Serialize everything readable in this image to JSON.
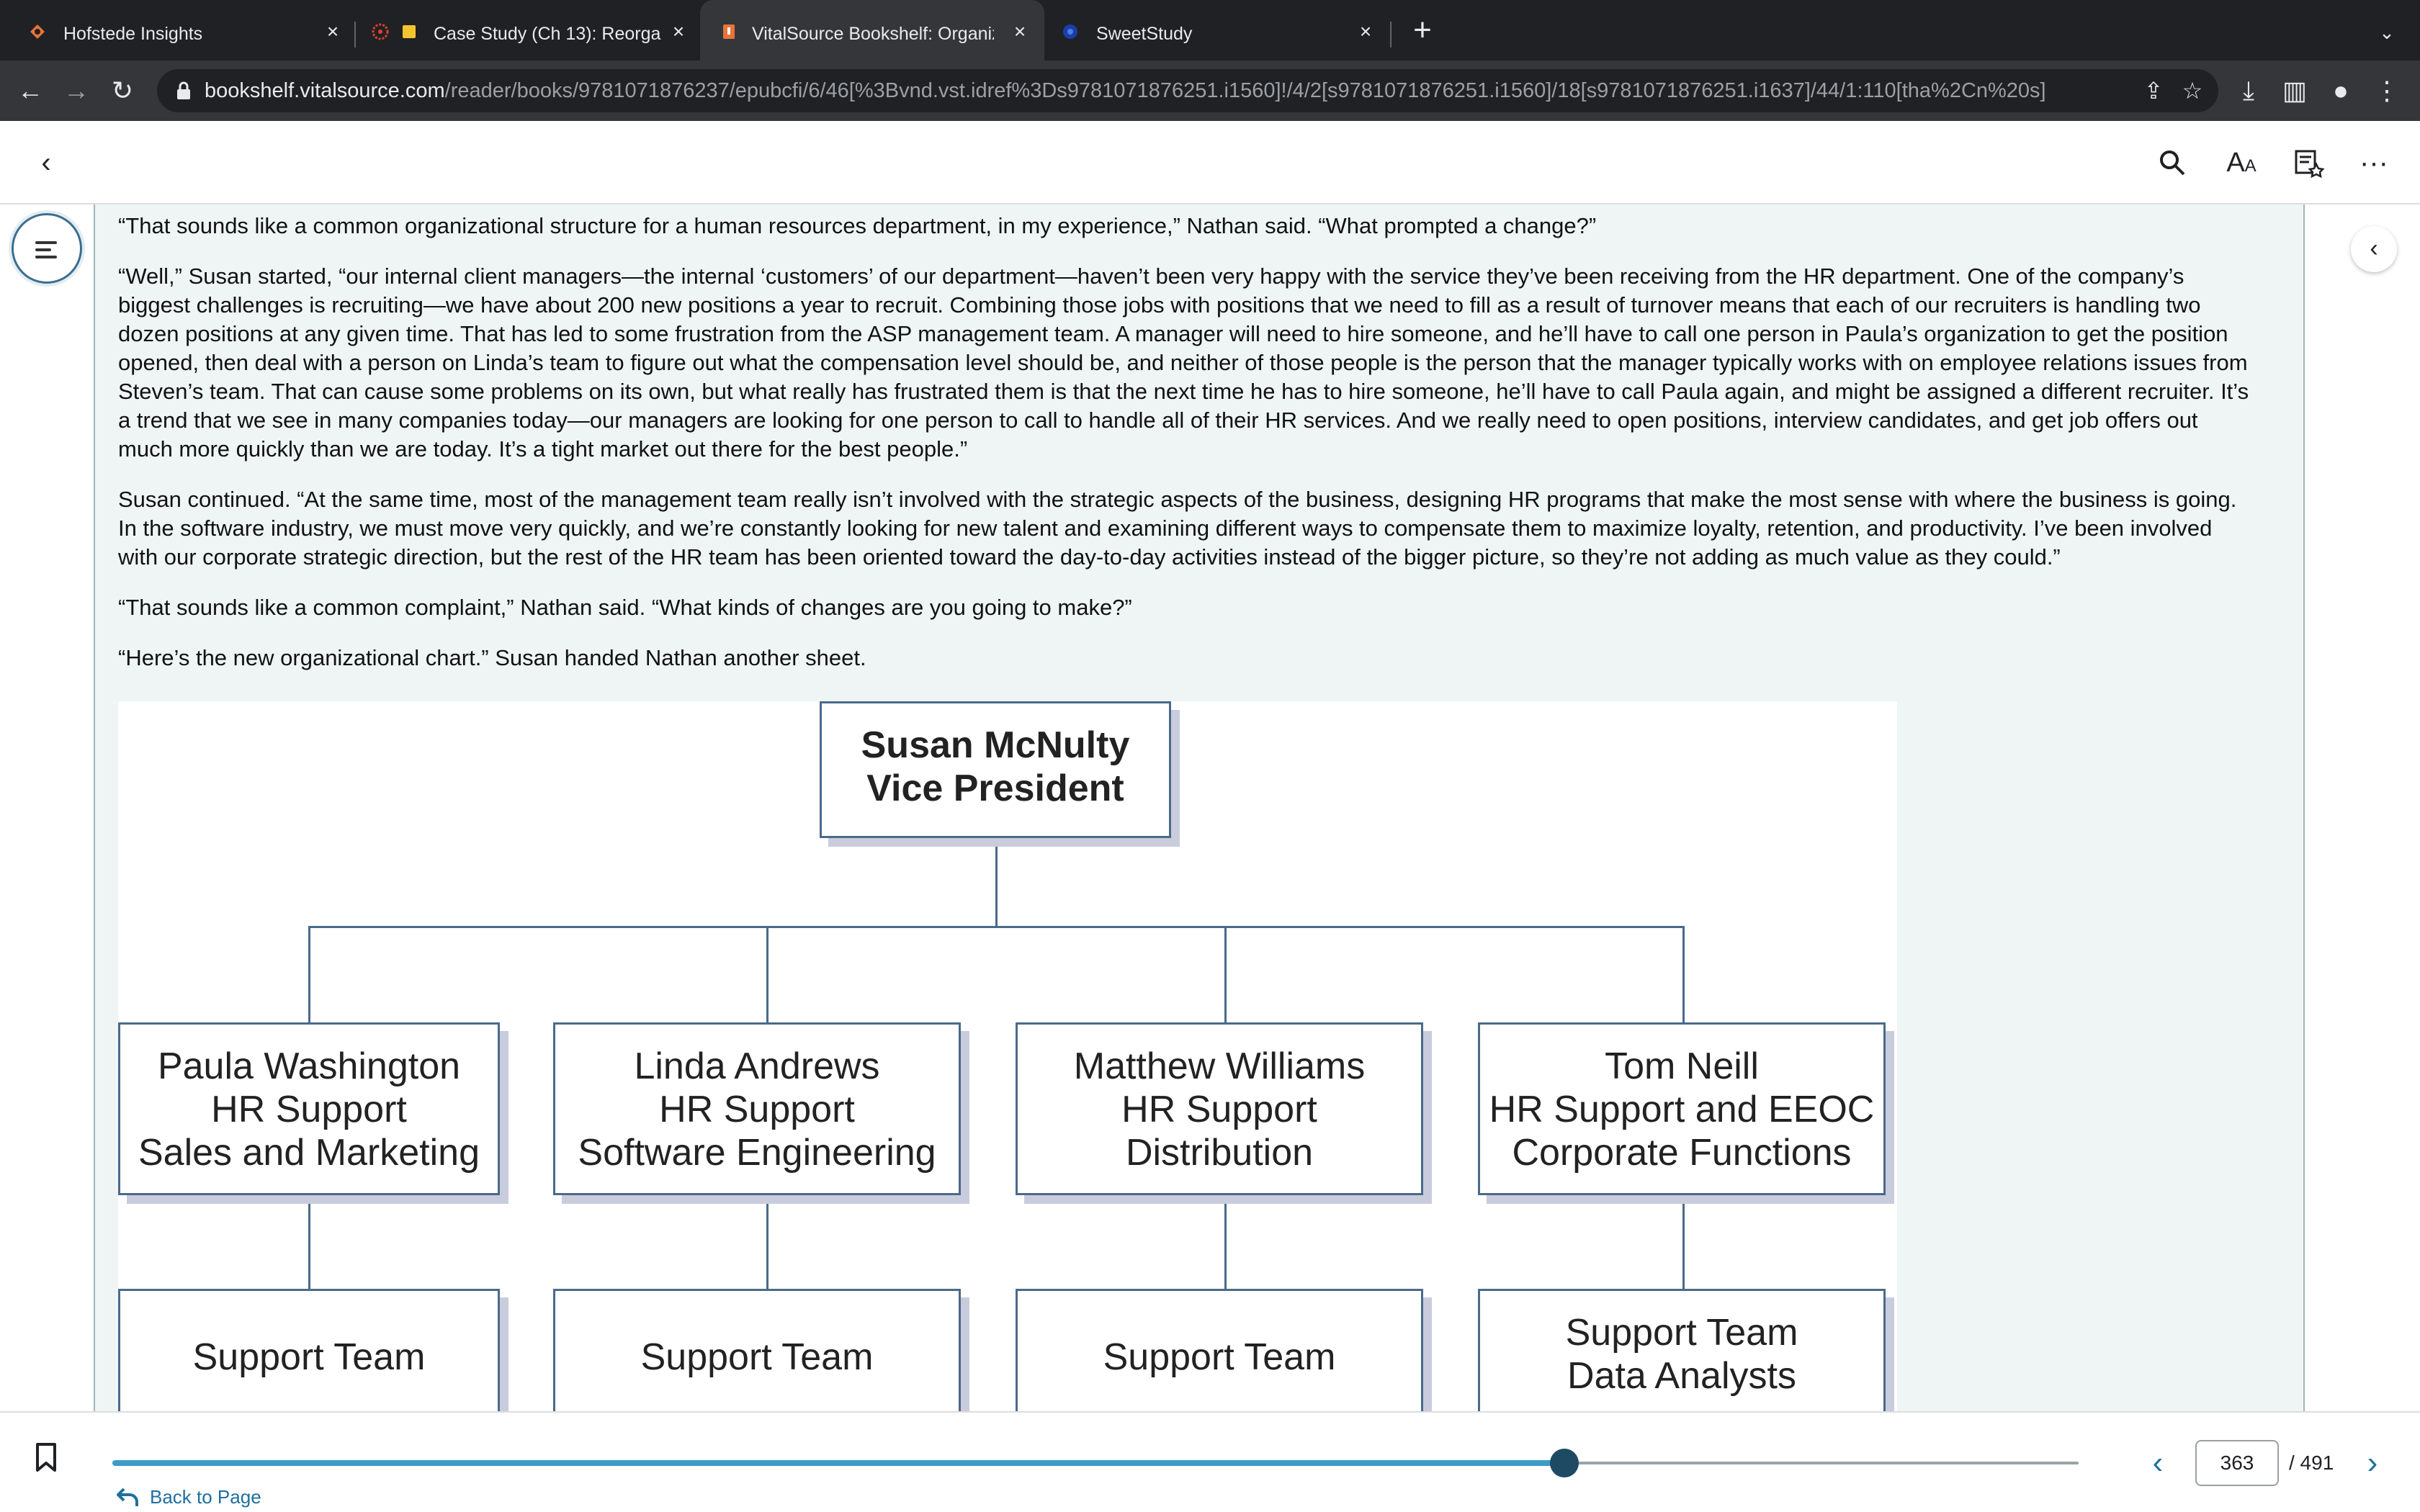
{
  "browser": {
    "tabs": [
      {
        "title": "Hofstede Insights",
        "active": false
      },
      {
        "title": "Case Study (Ch 13): Reorga",
        "active": false
      },
      {
        "title": "VitalSource Bookshelf: Organiz",
        "active": true
      },
      {
        "title": "SweetStudy",
        "active": false
      }
    ],
    "url_host": "bookshelf.vitalsource.com",
    "url_path": "/reader/books/9781071876237/epubcfi/6/46[%3Bvnd.vst.idref%3Ds9781071876251.i1560]!/4/2[s9781071876251.i1560]/18[s9781071876251.i1637]/44/1:110[tha%2Cn%20s]"
  },
  "reader": {
    "paragraphs": [
      "“That sounds like a common organizational structure for a human resources department, in my experience,” Nathan said. “What prompted a change?”",
      "“Well,” Susan started, “our internal client managers—the internal ‘customers’ of our department—haven’t been very happy with the service they’ve been receiving from the HR department. One of the company’s biggest challenges is recruiting—we have about 200 new positions a year to recruit. Combining those jobs with positions that we need to fill as a result of turnover means that each of our recruiters is handling two dozen positions at any given time. That has led to some frustration from the ASP management team. A manager will need to hire someone, and he’ll have to call one person in Paula’s organization to get the position opened, then deal with a person on Linda’s team to figure out what the compensation level should be, and neither of those people is the person that the manager typically works with on employee relations issues from Steven’s team. That can cause some problems on its own, but what really has frustrated them is that the next time he has to hire someone, he’ll have to call Paula again, and might be assigned a different recruiter. It’s a trend that we see in many companies today—our managers are looking for one person to call to handle all of their HR services. And we really need to open positions, interview candidates, and get job offers out much more quickly than we are today. It’s a tight market out there for the best people.”",
      "Susan continued. “At the same time, most of the management team really isn’t involved with the strategic aspects of the business, designing HR programs that make the most sense with where the business is going. In the software industry, we must move very quickly, and we’re constantly looking for new talent and examining different ways to compensate them to maximize loyalty, retention, and productivity. I’ve been involved with our corporate strategic direction, but the rest of the HR team has been oriented toward the day-to-day activities instead of the bigger picture, so they’re not adding as much value as they could.”",
      "“That sounds like a common complaint,” Nathan said. “What kinds of changes are you going to make?”",
      "“Here’s the new organizational chart.” Susan handed Nathan another sheet."
    ],
    "org_chart": {
      "top": {
        "name": "Susan McNulty",
        "title": "Vice President"
      },
      "managers": [
        {
          "name": "Paula Washington",
          "role": "HR Support",
          "area": "Sales and Marketing"
        },
        {
          "name": "Linda Andrews",
          "role": "HR Support",
          "area": "Software Engineering"
        },
        {
          "name": "Matthew Williams",
          "role": "HR Support",
          "area": "Distribution"
        },
        {
          "name": "Tom Neill",
          "role": "HR Support and EEOC",
          "area": "Corporate Functions"
        }
      ],
      "teams": [
        {
          "line1": "Support Team",
          "line2": ""
        },
        {
          "line1": "Support Team",
          "line2": ""
        },
        {
          "line1": "Support Team",
          "line2": ""
        },
        {
          "line1": "Support Team",
          "line2": "Data Analysts"
        }
      ]
    }
  },
  "footer": {
    "back_to_page": "Back to Page",
    "current_page": "363",
    "total_pages": "/ 491",
    "progress_fraction": 0.7385
  },
  "colors": {
    "page_bg": "#eef5f4",
    "accent": "#1f6f9e",
    "slider_fill": "#3d9bc7",
    "slider_thumb": "#1e4a63",
    "org_border": "#4a6a8a"
  }
}
